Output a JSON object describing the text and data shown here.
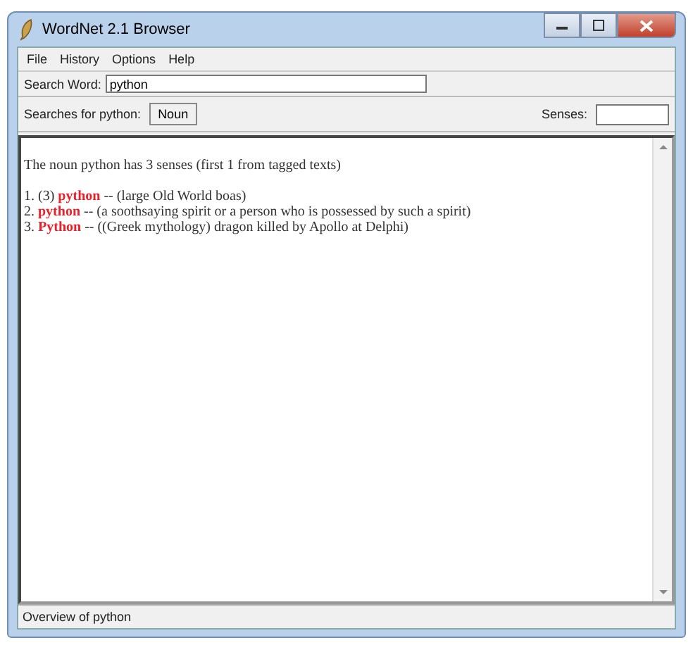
{
  "window": {
    "title": "WordNet 2.1 Browser"
  },
  "menu": [
    "File",
    "History",
    "Options",
    "Help"
  ],
  "search": {
    "label": "Search Word:",
    "value": "python"
  },
  "searches": {
    "label": "Searches for python:",
    "buttons": [
      "Noun"
    ],
    "senses_label": "Senses:"
  },
  "results": {
    "summary": "The noun python has 3 senses (first 1 from tagged texts)",
    "senses": [
      {
        "prefix": "1. (3)",
        "word": "python",
        "gloss": "-- (large Old World boas)"
      },
      {
        "prefix": "2.",
        "word": "python",
        "gloss": "-- (a soothsaying spirit or a person who is possessed by such a spirit)"
      },
      {
        "prefix": "3.",
        "word": "Python",
        "gloss": "-- ((Greek mythology) dragon killed by Apollo at Delphi)"
      }
    ]
  },
  "status_bar": "Overview of python"
}
